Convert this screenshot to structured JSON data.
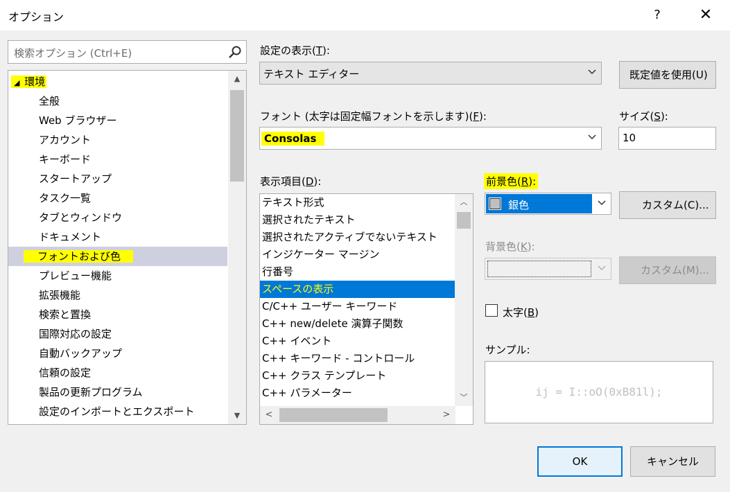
{
  "window": {
    "title": "オプション",
    "help_label": "?",
    "close_label": "✕"
  },
  "search": {
    "placeholder": "検索オプション (Ctrl+E)",
    "icon": "search-icon"
  },
  "tree": {
    "root": "環境",
    "items": [
      "全般",
      "Web ブラウザー",
      "アカウント",
      "キーボード",
      "スタートアップ",
      "タスク一覧",
      "タブとウィンドウ",
      "ドキュメント",
      "フォントおよび色",
      "プレビュー機能",
      "拡張機能",
      "検索と置換",
      "国際対応の設定",
      "自動バックアップ",
      "信頼の設定",
      "製品の更新プログラム",
      "設定のインポートとエクスポート"
    ],
    "selected": "フォントおよび色"
  },
  "settings_for": {
    "label_pre": "設定の表示(",
    "label_key": "T",
    "label_post": "):",
    "value": "テキスト エディター"
  },
  "use_defaults_button": "既定値を使用(U)",
  "font": {
    "label_pre": "フォント (太字は固定幅フォントを示します)(",
    "label_key": "F",
    "label_post": "):",
    "value": "Consolas"
  },
  "size": {
    "label_pre": "サイズ(",
    "label_key": "S",
    "label_post": "):",
    "value": "10"
  },
  "display_items": {
    "label_pre": "表示項目(",
    "label_key": "D",
    "label_post": "):",
    "items": [
      "テキスト形式",
      "選択されたテキスト",
      "選択されたアクティブでないテキスト",
      "インジケーター マージン",
      "行番号",
      "スペースの表示",
      "C/C++ ユーザー キーワード",
      "C++ new/delete 演算子関数",
      "C++ イベント",
      "C++ キーワード - コントロール",
      "C++ クラス テンプレート",
      "C++ パラメーター"
    ],
    "selected": "スペースの表示"
  },
  "foreground": {
    "label_pre": "前景色(",
    "label_key": "R",
    "label_post": "):",
    "value": "銀色",
    "swatch_color": "#c0c0c0",
    "custom_button": "カスタム(C)..."
  },
  "background": {
    "label_pre": "背景色(",
    "label_key": "K",
    "label_post": "):",
    "custom_button": "カスタム(M)..."
  },
  "bold": {
    "label_pre": "太字(",
    "label_key": "B",
    "label_post": ")",
    "checked": false
  },
  "sample": {
    "label": "サンプル:",
    "text": "ij = I::oO(0xB81l);"
  },
  "ok_button": "OK",
  "cancel_button": "キャンセル",
  "colors": {
    "highlight": "#ffff00",
    "selection": "#0078d7",
    "tree_selection": "#cfd0df"
  }
}
